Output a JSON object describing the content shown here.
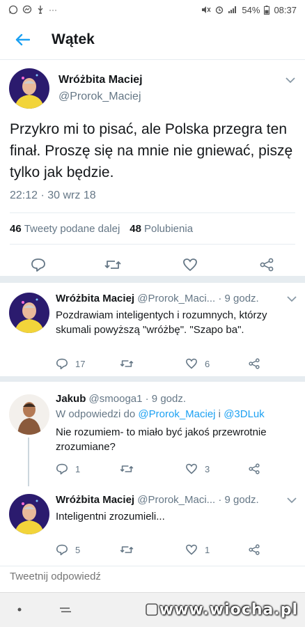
{
  "status_bar": {
    "battery": "54%",
    "time": "08:37",
    "left_icons": [
      "whatsapp-icon",
      "messenger-icon",
      "usb-icon",
      "more-icon"
    ]
  },
  "header": {
    "title": "Wątek"
  },
  "main_tweet": {
    "name": "Wróżbita Maciej",
    "handle": "@Prorok_Maciej",
    "text": "Przykro mi to pisać, ale Polska przegra ten finał. Proszę się na mnie nie gniewać, piszę tylko jak będzie.",
    "timestamp": "22:12 · 30 wrz 18",
    "retweets_count": "46",
    "retweets_label": "Tweety podane dalej",
    "likes_count": "48",
    "likes_label": "Polubienia"
  },
  "replies": [
    {
      "name": "Wróżbita Maciej",
      "handle": "@Prorok_Maci...",
      "time": "· 9 godz.",
      "text": "Pozdrawiam inteligentych i rozumnych, którzy skumali powyższą \"wróżbę\". \"Szapo ba\".",
      "replies": "17",
      "retweets": "",
      "likes": "6"
    },
    {
      "name": "Jakub",
      "handle": "@smooga1",
      "time": "· 9 godz.",
      "reply_to_prefix": "W odpowiedzi do",
      "reply_to_user1": "@Prorok_Maciej",
      "reply_to_and": "i",
      "reply_to_user2": "@3DLuk",
      "text": "Nie rozumiem- to miało być jakoś przewrotnie zrozumiane?",
      "replies": "1",
      "retweets": "",
      "likes": "3"
    },
    {
      "name": "Wróżbita Maciej",
      "handle": "@Prorok_Maci...",
      "time": "· 9 godz.",
      "text": "Inteligentni zrozumieli...",
      "replies": "5",
      "retweets": "",
      "likes": "1"
    }
  ],
  "compose": {
    "placeholder": "Tweetnij odpowiedź"
  },
  "watermark": "www.wiocha.pl",
  "colors": {
    "accent": "#1da1f2",
    "secondary_text": "#657786",
    "divider": "#e6ecf0"
  }
}
